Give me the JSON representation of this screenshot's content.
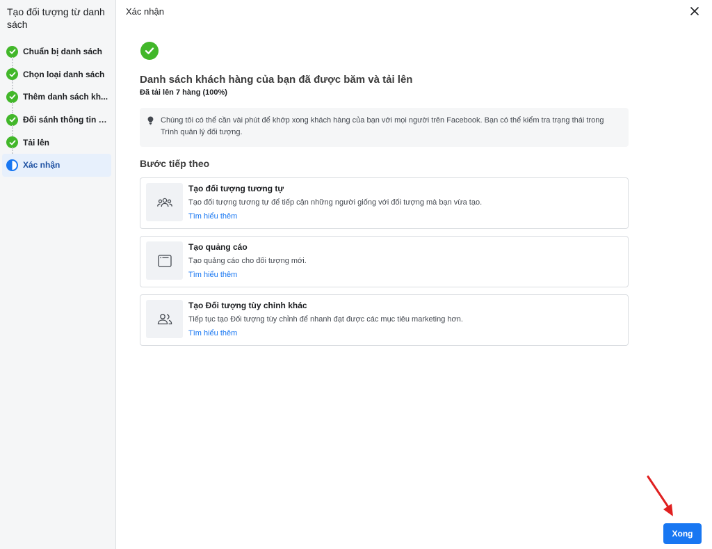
{
  "sidebar": {
    "title": "Tạo đối tượng từ danh sách",
    "steps": [
      {
        "label": "Chuẩn bị danh sách",
        "state": "done"
      },
      {
        "label": "Chọn loại danh sách",
        "state": "done"
      },
      {
        "label": "Thêm danh sách kh...",
        "state": "done"
      },
      {
        "label": "Đối sánh thông tin n...",
        "state": "done"
      },
      {
        "label": "Tải lên",
        "state": "done"
      },
      {
        "label": "Xác nhận",
        "state": "active"
      }
    ]
  },
  "header": {
    "title": "Xác nhận",
    "close_icon": "close-icon"
  },
  "result": {
    "headline": "Danh sách khách hàng của bạn đã được băm và tải lên",
    "subline": "Đã tải lên 7 hàng (100%)"
  },
  "info": {
    "text": "Chúng tôi có thể cần vài phút để khớp xong khách hàng của bạn với mọi người trên Facebook. Bạn có thể kiểm tra trạng thái trong Trình quản lý đối tượng."
  },
  "next_steps": {
    "title": "Bước tiếp theo",
    "cards": [
      {
        "title": "Tạo đối tượng tương tự",
        "desc": "Tạo đối tượng tương tự để tiếp cận những người giống với đối tượng mà bạn vừa tạo.",
        "link": "Tìm hiểu thêm",
        "icon": "group-icon"
      },
      {
        "title": "Tạo quảng cáo",
        "desc": "Tạo quảng cáo cho đối tượng mới.",
        "link": "Tìm hiểu thêm",
        "icon": "browser-window-icon"
      },
      {
        "title": "Tạo Đối tượng tùy chỉnh khác",
        "desc": "Tiếp tục tạo Đối tượng tùy chỉnh để nhanh đạt được các mục tiêu marketing hơn.",
        "link": "Tìm hiểu thêm",
        "icon": "people-icon"
      }
    ]
  },
  "footer": {
    "done_label": "Xong"
  },
  "colors": {
    "accent": "#1877f2",
    "success": "#42b72a",
    "annotation_arrow": "#e02020"
  }
}
